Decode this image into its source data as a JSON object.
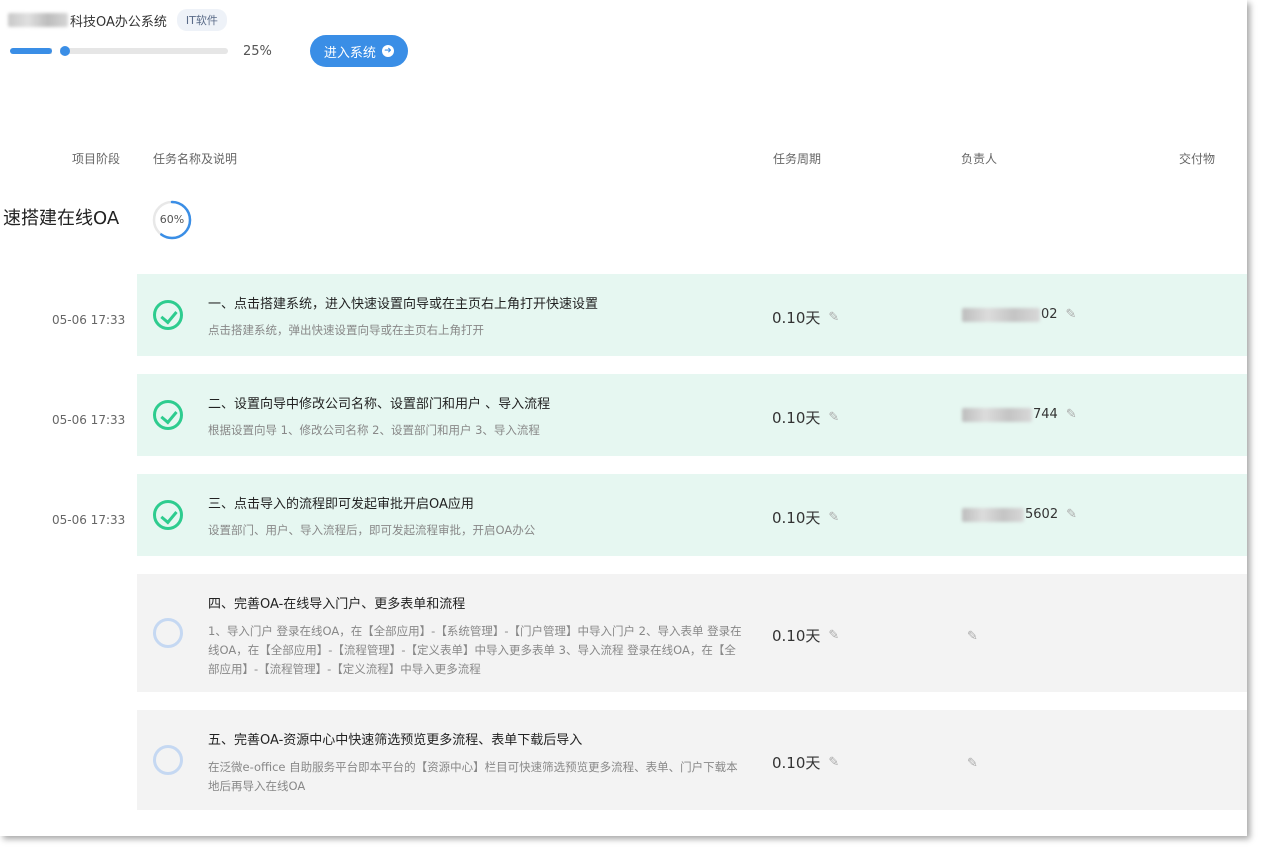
{
  "header": {
    "company_suffix": "科技OA办公系统",
    "tag": "IT软件",
    "progress_pct": "25%",
    "progress_value": 0.25,
    "enter_button": "进入系统"
  },
  "columns": {
    "stage": "项目阶段",
    "task": "任务名称及说明",
    "period": "任务周期",
    "owner": "负责人",
    "deliverable": "交付物"
  },
  "stage": {
    "title": "速搭建在线OA",
    "progress": "60%",
    "progress_value": 0.6
  },
  "tasks": [
    {
      "date": "05-06 17:33",
      "status": "done",
      "title": "一、点击搭建系统，进入快速设置向导或在主页右上角打开快速设置",
      "desc": "点击搭建系统，弹出快速设置向导或在主页右上角打开",
      "period": "0.10天",
      "owner_suffix": "02"
    },
    {
      "date": "05-06 17:33",
      "status": "done",
      "title": "二、设置向导中修改公司名称、设置部门和用户 、导入流程",
      "desc": "根据设置向导 1、修改公司名称 2、设置部门和用户 3、导入流程",
      "period": "0.10天",
      "owner_suffix": "744"
    },
    {
      "date": "05-06 17:33",
      "status": "done",
      "title": "三、点击导入的流程即可发起审批开启OA应用",
      "desc": "设置部门、用户、导入流程后，即可发起流程审批，开启OA办公",
      "period": "0.10天",
      "owner_suffix": "5602"
    },
    {
      "date": "",
      "status": "todo",
      "title": "四、完善OA-在线导入门户、更多表单和流程",
      "desc": "1、导入门户 登录在线OA，在【全部应用】-【系统管理】-【门户管理】中导入门户 2、导入表单 登录在线OA，在【全部应用】-【流程管理】-【定义表单】中导入更多表单 3、导入流程 登录在线OA，在【全部应用】-【流程管理】-【定义流程】中导入更多流程",
      "period": "0.10天",
      "owner_suffix": ""
    },
    {
      "date": "",
      "status": "todo",
      "title": "五、完善OA-资源中心中快速筛选预览更多流程、表单下载后导入",
      "desc": "在泛微e-office 自助服务平台即本平台的【资源中心】栏目可快速筛选预览更多流程、表单、门户下载本地后再导入在线OA",
      "period": "0.10天",
      "owner_suffix": ""
    }
  ],
  "icons": {
    "edit": "pencil-icon",
    "done": "check-circle-icon",
    "todo": "empty-circle-icon",
    "enter": "arrow-right-circle-icon"
  },
  "colors": {
    "accent": "#3a8ee6",
    "done_green": "#2ecc8f",
    "done_row_bg": "#e6f7f1",
    "todo_row_bg": "#f3f3f3"
  }
}
